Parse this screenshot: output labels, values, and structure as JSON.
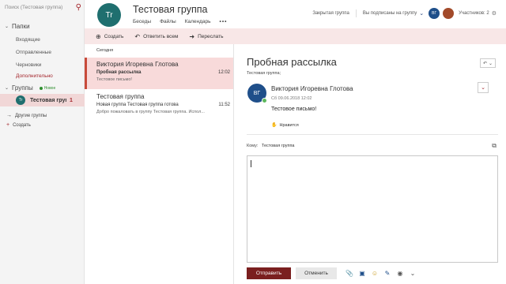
{
  "search": {
    "placeholder": "Поиск (Тестовая группа)"
  },
  "sidebar": {
    "folders_heading": "Папки",
    "folders": [
      "Входящие",
      "Отправленные",
      "Черновики",
      "Дополнительно"
    ],
    "groups_heading": "Группы",
    "groups_new_badge": "Новое",
    "group": {
      "avatar": "Tr",
      "name": "Тестовая группа",
      "count": "1"
    },
    "links": {
      "other_groups": "Другие группы",
      "create": "Создать"
    }
  },
  "header": {
    "avatar": "Tr",
    "title": "Тестовая группа",
    "tabs": [
      "Беседы",
      "Файлы",
      "Календарь"
    ],
    "more": "•••",
    "privacy": "Закрытая группа",
    "subscription": "Вы подписаны на группу",
    "user_initials": "ВГ",
    "members": "Участников: 2"
  },
  "toolbar": {
    "create": "Создать",
    "reply_all": "Ответить всем",
    "forward": "Переслать"
  },
  "message_list": {
    "date_header": "Сегодня",
    "items": [
      {
        "from": "Виктория Игоревна Глотова",
        "subject": "Пробная рассылка",
        "time": "12:02",
        "preview": "Тестовое письмо!"
      },
      {
        "from": "Тестовая группа",
        "subject": "Новая группа Тестовая группа готова",
        "time": "11:52",
        "preview": "Добро пожаловать в группу Тестовая группа. Испол..."
      }
    ]
  },
  "reading": {
    "subject": "Пробная рассылка",
    "group_label": "Тестовая группа;",
    "sender_initials": "ВГ",
    "sender_name": "Виктория Игоревна Глотова",
    "sent_date": "Сб 09.06.2018 12:02",
    "body": "Тестовое письмо!",
    "like": "Нравится",
    "to_label": "Кому:",
    "to_value": "Тестовая группа"
  },
  "compose": {
    "send": "Отправить",
    "discard": "Отменить"
  },
  "colors": {
    "accent": "#a4262c",
    "selected_bg": "#f8dada",
    "send_bg": "#7a1f1f",
    "toolbar_bg": "#f8e7e7"
  }
}
